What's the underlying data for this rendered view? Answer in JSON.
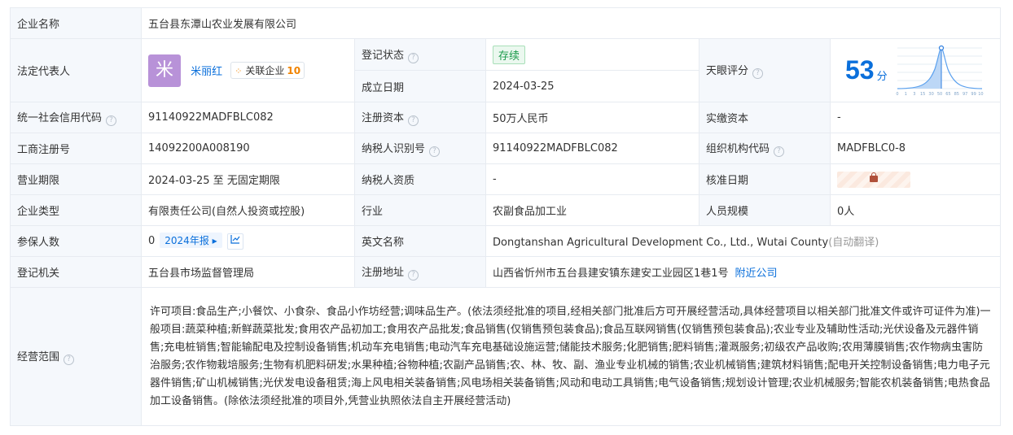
{
  "company_name_label": "企业名称",
  "company_name": "五台县东潭山农业发展有限公司",
  "legal_rep_label": "法定代表人",
  "legal_rep_avatar": "米",
  "legal_rep_name": "米丽红",
  "related_label": "关联企业",
  "related_count": "10",
  "reg_status_label": "登记状态",
  "reg_status": "存续",
  "found_date_label": "成立日期",
  "found_date": "2024-03-25",
  "tianyan_label": "天眼评分",
  "score": "53",
  "score_unit": "分",
  "score_axis": [
    "0",
    "1",
    "3",
    "15",
    "30",
    "50",
    "65",
    "85",
    "97",
    "99",
    "100"
  ],
  "score_fraction": 0.53,
  "credit_code_label": "统一社会信用代码",
  "credit_code": "91140922MADFBLC082",
  "reg_capital_label": "注册资本",
  "reg_capital": "50万人民币",
  "paid_capital_label": "实缴资本",
  "paid_capital": "-",
  "biz_reg_no_label": "工商注册号",
  "biz_reg_no": "14092200A008190",
  "taxpayer_id_label": "纳税人识别号",
  "taxpayer_id": "91140922MADFBLC082",
  "org_code_label": "组织机构代码",
  "org_code": "MADFBLC0-8",
  "term_label": "营业期限",
  "term": "2024-03-25 至 无固定期限",
  "taxpayer_qual_label": "纳税人资质",
  "taxpayer_qual": "-",
  "approve_date_label": "核准日期",
  "type_label": "企业类型",
  "type": "有限责任公司(自然人投资或控股)",
  "industry_label": "行业",
  "industry": "农副食品加工业",
  "staff_size_label": "人员规模",
  "staff_size": "0人",
  "insured_label": "参保人数",
  "insured": "0",
  "annual_report": "2024年报",
  "english_name_label": "英文名称",
  "english_name": "Dongtanshan Agricultural Development Co., Ltd., Wutai County",
  "auto_translate": "(自动翻译)",
  "reg_authority_label": "登记机关",
  "reg_authority": "五台县市场监督管理局",
  "reg_address_label": "注册地址",
  "reg_address": "山西省忻州市五台县建安镇东建安工业园区1巷1号",
  "nearby": "附近公司",
  "scope_label": "经营范围",
  "scope": "许可项目:食品生产;小餐饮、小食杂、食品小作坊经营;调味品生产。(依法须经批准的项目,经相关部门批准后方可开展经营活动,具体经营项目以相关部门批准文件或许可证件为准)一般项目:蔬菜种植;新鲜蔬菜批发;食用农产品初加工;食用农产品批发;食品销售(仅销售预包装食品);食品互联网销售(仅销售预包装食品);农业专业及辅助性活动;光伏设备及元器件销售;充电桩销售;智能输配电及控制设备销售;机动车充电销售;电动汽车充电基础设施运营;储能技术服务;化肥销售;肥料销售;灌溉服务;初级农产品收购;农用薄膜销售;农作物病虫害防治服务;农作物栽培服务;生物有机肥料研发;水果种植;谷物种植;农副产品销售;农、林、牧、副、渔业专业机械的销售;农业机械销售;建筑材料销售;配电开关控制设备销售;电力电子元器件销售;矿山机械销售;光伏发电设备租赁;海上风电相关装备销售;风电场相关装备销售;风动和电动工具销售;电气设备销售;规划设计管理;农业机械服务;智能农机装备销售;电热食品加工设备销售。(除依法须经批准的项目外,凭营业执照依法自主开展经营活动)"
}
